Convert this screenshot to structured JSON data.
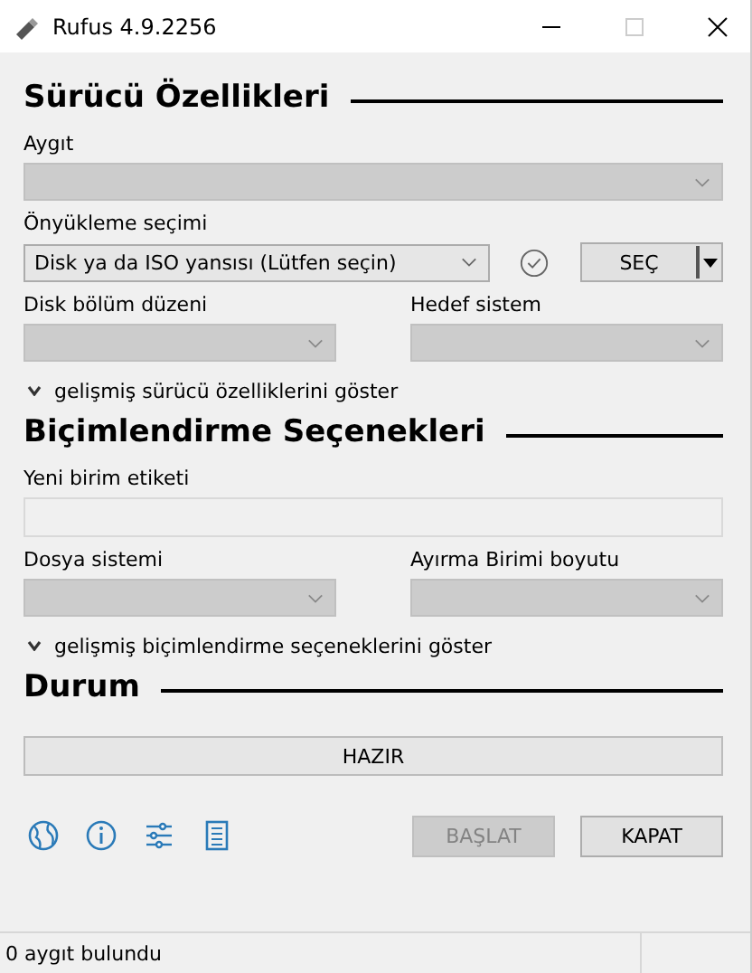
{
  "window": {
    "title": "Rufus 4.9.2256"
  },
  "sections": [
    {
      "heading": "Sürücü Özellikleri",
      "rows": [
        {
          "fields": [
            {
              "label": "Aygıt",
              "kind": "dropdown",
              "disabled": true
            }
          ]
        },
        {
          "fields": [
            {
              "label": "Önyükleme seçimi",
              "kind": "boot",
              "value": "Disk ya da ISO yansısı (Lütfen seçin)",
              "disabled": false,
              "button": "SEÇ"
            }
          ]
        },
        {
          "fields": [
            {
              "label": "Disk bölüm düzeni",
              "kind": "dropdown",
              "disabled": true
            },
            {
              "label": "Hedef sistem",
              "kind": "dropdown",
              "disabled": true
            }
          ]
        }
      ],
      "toggle": {
        "label": "gelişmiş sürücü özelliklerini göster",
        "expanded": false
      }
    },
    {
      "heading": "Biçimlendirme Seçenekleri",
      "rows": [
        {
          "fields": [
            {
              "label": "Yeni birim etiketi",
              "kind": "text",
              "disabled": true
            }
          ]
        },
        {
          "fields": [
            {
              "label": "Dosya sistemi",
              "kind": "dropdown",
              "disabled": true
            },
            {
              "label": "Ayırma Birimi boyutu",
              "kind": "dropdown",
              "disabled": true
            }
          ]
        }
      ],
      "toggle": {
        "label": "gelişmiş biçimlendirme seçeneklerini göster",
        "expanded": false
      }
    },
    {
      "heading": "Durum",
      "status": "HAZIR"
    }
  ],
  "buttons": [
    {
      "label": "BAŞLAT",
      "disabled": true
    },
    {
      "label": "KAPAT",
      "disabled": false
    }
  ],
  "status_bar": {
    "text": "0 aygıt bulundu"
  }
}
